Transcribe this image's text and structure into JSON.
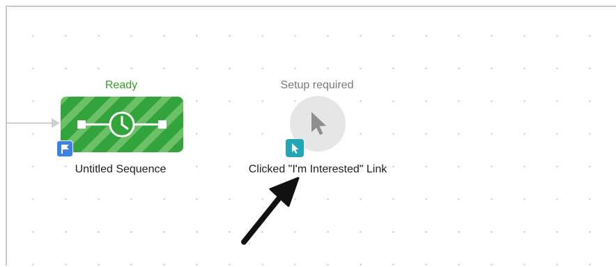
{
  "nodes": {
    "sequence": {
      "status": "Ready",
      "label": "Untitled Sequence",
      "icon": "clock-icon",
      "badge_icon": "flag-icon",
      "color": "#32a43b"
    },
    "trigger": {
      "status": "Setup required",
      "label": "Clicked \"I'm Interested\" Link",
      "icon": "cursor-icon",
      "badge_icon": "cursor-icon",
      "badge_color": "#22a6b3"
    }
  },
  "colors": {
    "ready": "#3a9c2f",
    "setup": "#7a7a7a",
    "flag_badge": "#3b82e6",
    "annotation_arrow": "#111111"
  }
}
